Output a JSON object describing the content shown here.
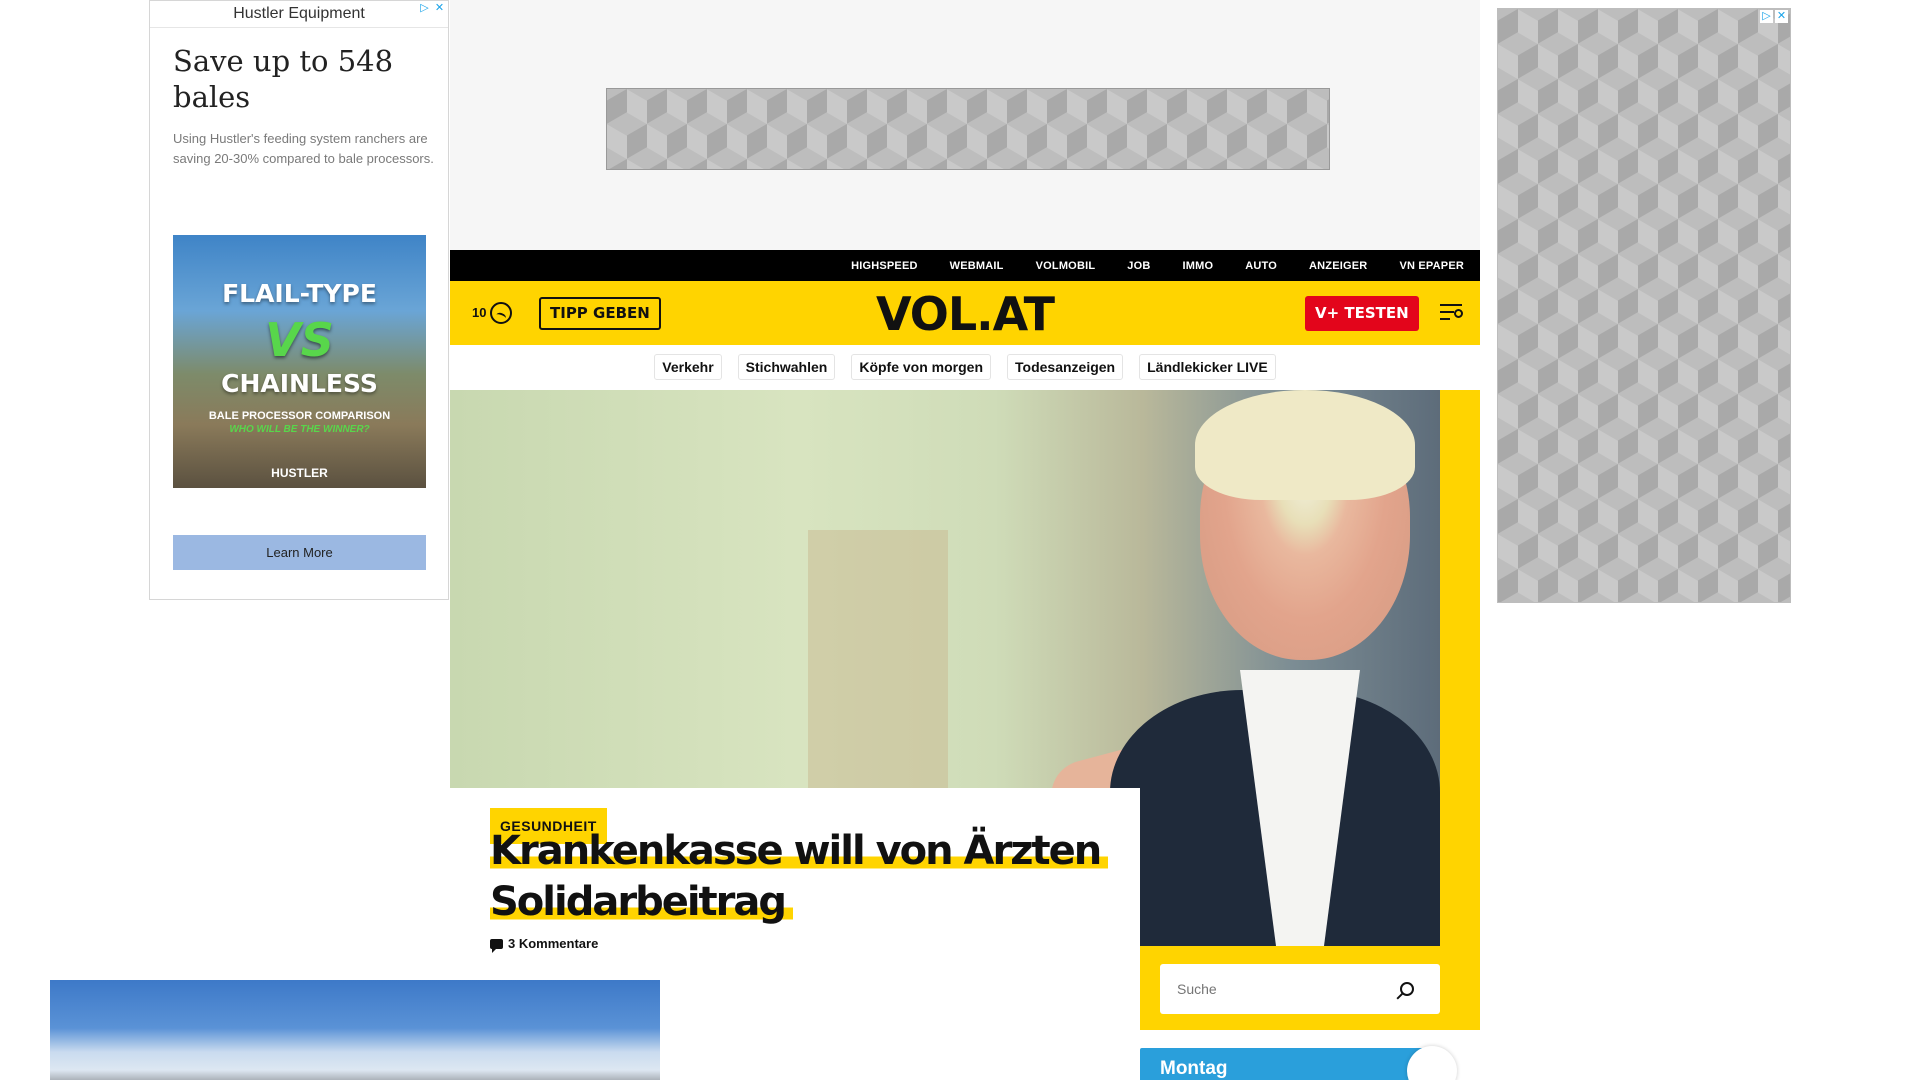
{
  "left_ad": {
    "sponsor": "Hustler Equipment",
    "headline": "Save up to 548 bales",
    "body": "Using Hustler's feeding system ranchers are saving 20-30% compared to bale processors.",
    "creative_lines": [
      "FLAIL-TYPE",
      "VS",
      "CHAINLESS",
      "BALE PROCESSOR COMPARISON",
      "WHO WILL BE THE WINNER?",
      "HUSTLER"
    ],
    "cta": "Learn More"
  },
  "ad_choices": {
    "info_glyph": "▷",
    "close_glyph": "✕"
  },
  "topbar": {
    "links": [
      "HIGHSPEED",
      "WEBMAIL",
      "VOLMOBIL",
      "JOB",
      "IMMO",
      "AUTO",
      "ANZEIGER",
      "VN EPAPER"
    ]
  },
  "header": {
    "count": "10",
    "tipp_label": "TIPP GEBEN",
    "logo": "VOL.AT",
    "vplus_label": "V+ TESTEN",
    "accent": "#ffd400",
    "vplus_color": "#e3051b"
  },
  "subnav": {
    "items": [
      "Verkehr",
      "Stichwahlen",
      "Köpfe von morgen",
      "Todesanzeigen",
      "Ländlekicker LIVE"
    ]
  },
  "article": {
    "category": "GESUNDHEIT",
    "headline_line1": "Krankenkasse will von Ärzten",
    "headline_line2": "Solidarbeitrag",
    "comments": "3 Kommentare"
  },
  "search": {
    "placeholder": "Suche"
  },
  "weather": {
    "day": "Montag",
    "accent": "#2a9fdb"
  }
}
